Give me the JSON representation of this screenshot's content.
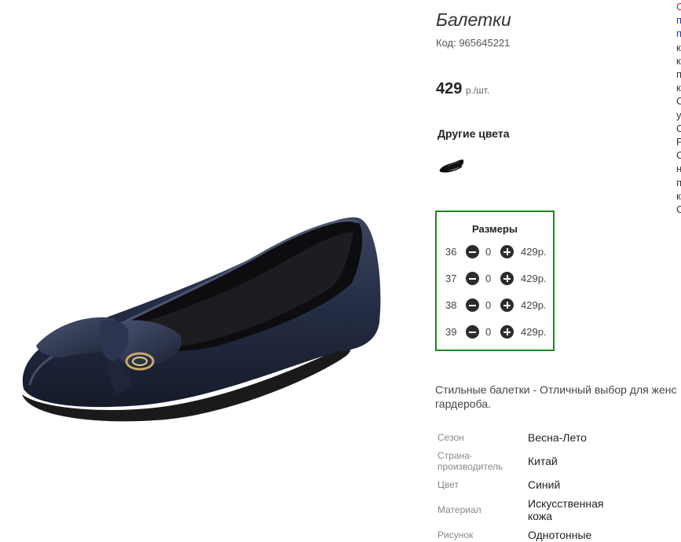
{
  "product": {
    "title": "Балетки",
    "code": "Код: 965645221",
    "price_value": "429",
    "price_unit": "р./шт."
  },
  "other_colors": {
    "heading": "Другие цвета"
  },
  "sizes": {
    "heading": "Размеры",
    "rows": [
      {
        "size": "36",
        "qty": "0",
        "price": "429р."
      },
      {
        "size": "37",
        "qty": "0",
        "price": "429р."
      },
      {
        "size": "38",
        "qty": "0",
        "price": "429р."
      },
      {
        "size": "39",
        "qty": "0",
        "price": "429р."
      }
    ]
  },
  "description": {
    "line1": "Стильные балетки - Отличный выбор для женс",
    "line2": "гардероба."
  },
  "properties": [
    {
      "label": "Сезон",
      "value": "Весна-Лето"
    },
    {
      "label": "Страна-производитель",
      "label_line1": "Страна-",
      "label_line2": "производитель",
      "value": "Китай"
    },
    {
      "label": "Цвет",
      "value": "Синий"
    },
    {
      "label": "Материал",
      "value": "Искусственная кожа",
      "value_line1": "Искусственная",
      "value_line2": "кожа"
    },
    {
      "label": "Рисунок",
      "value": "Однотонные"
    }
  ],
  "right_edge_chars": [
    "С",
    "п",
    "п",
    "к",
    "к",
    "п",
    "к",
    "С",
    "у",
    "С",
    "Р",
    "С",
    "н",
    "п",
    "к",
    "С"
  ],
  "colors": {
    "border_green": "#188a1a",
    "link_blue": "#1a37c9",
    "red": "#d11111",
    "shoe_navy": "#27304a"
  }
}
